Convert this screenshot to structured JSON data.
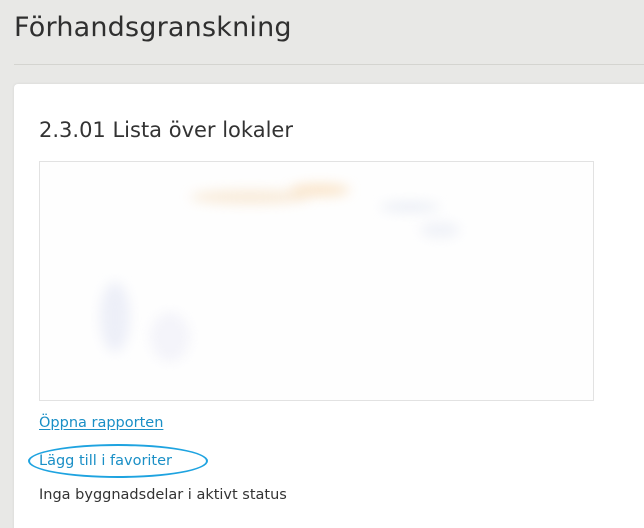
{
  "header": {
    "title": "Förhandsgranskning"
  },
  "report": {
    "title": "2.3.01 Lista över lokaler",
    "open_link": "Öppna rapporten",
    "favorite_link": "Lägg till i favoriter",
    "status": "Inga byggnadsdelar i aktivt status"
  },
  "colors": {
    "page_background": "#e8e8e6",
    "card_background": "#ffffff",
    "link": "#1a8fc6",
    "highlight_ring": "#1ea3e0"
  }
}
